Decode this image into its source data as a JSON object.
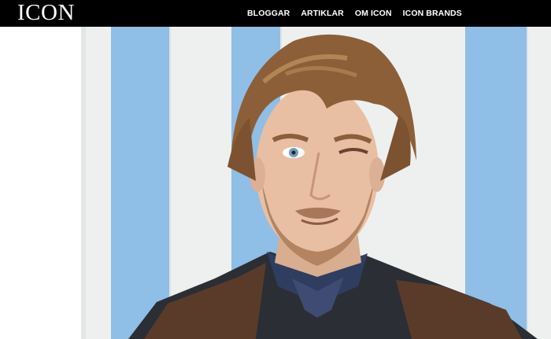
{
  "header": {
    "logo": "ICON",
    "nav": [
      {
        "label": "BLOGGAR"
      },
      {
        "label": "ARTIKLAR"
      },
      {
        "label": "OM ICON"
      },
      {
        "label": "ICON BRANDS"
      }
    ]
  },
  "colors": {
    "header_bg": "#000000",
    "stripe_blue": "#8fbee6",
    "wall_white": "#eef0ef"
  },
  "hero": {
    "image": "portrait-photo"
  }
}
